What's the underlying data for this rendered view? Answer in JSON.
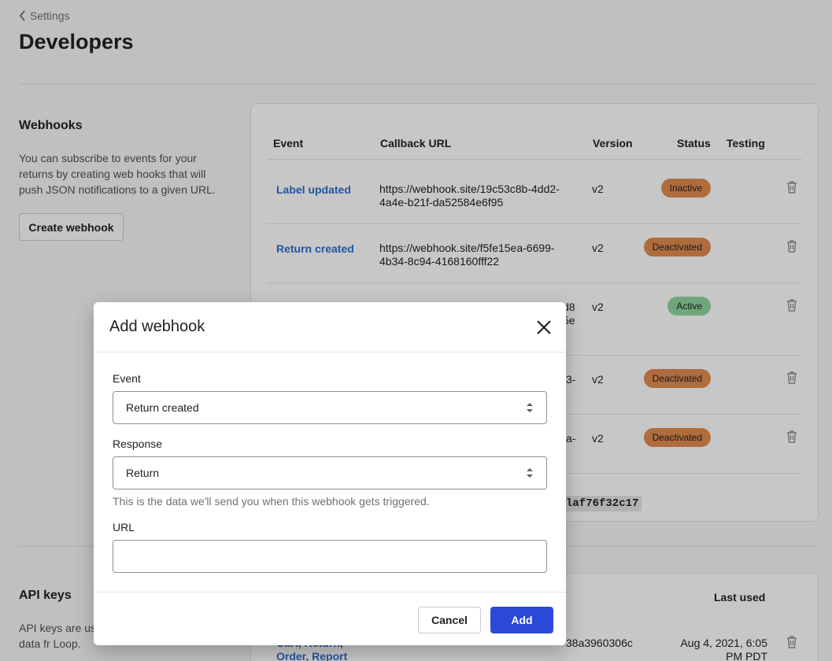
{
  "header": {
    "back_label": "Settings",
    "title": "Developers"
  },
  "webhooks": {
    "heading": "Webhooks",
    "description": "You can subscribe to events for your returns by creating web hooks that will push JSON notifications to a given URL.",
    "create_label": "Create webhook",
    "columns": [
      "Event",
      "Callback URL",
      "Version",
      "Status",
      "Testing"
    ],
    "rows": [
      {
        "event": "Label updated",
        "url": "https://webhook.site/19c53c8b-4dd2-4a4e-b21f-da52584e6f95",
        "version": "v2",
        "status": "Inactive"
      },
      {
        "event": "Return created",
        "url": "https://webhook.site/f5fe15ea-6699-4b34-8c94-4168160fff22",
        "version": "v2",
        "status": "Deactivated"
      },
      {
        "event": "",
        "url": "d8\n5e",
        "version": "v2",
        "status": "Active"
      },
      {
        "event": "",
        "url": "3-",
        "version": "v2",
        "status": "Deactivated"
      },
      {
        "event": "",
        "url": "a-",
        "version": "v2",
        "status": "Deactivated"
      }
    ],
    "secret_partial": "laf76f32c17",
    "status_colors": {
      "Inactive": "#e08b4f",
      "Deactivated": "#e08b4f",
      "Active": "#8fd69d"
    }
  },
  "api_keys": {
    "heading": "API keys",
    "description": "API keys are us returns data fr Loop.",
    "last_used_header": "Last used",
    "row": {
      "scopes": "Cart, Return, Order, Report",
      "key_partial": "38a3960306c",
      "last_used": "Aug 4, 2021, 6:05 PM PDT"
    }
  },
  "modal": {
    "title": "Add webhook",
    "event_label": "Event",
    "event_value": "Return created",
    "response_label": "Response",
    "response_value": "Return",
    "response_help": "This is the data we'll send you when this webhook gets triggered.",
    "url_label": "URL",
    "url_value": "",
    "cancel_label": "Cancel",
    "add_label": "Add"
  }
}
